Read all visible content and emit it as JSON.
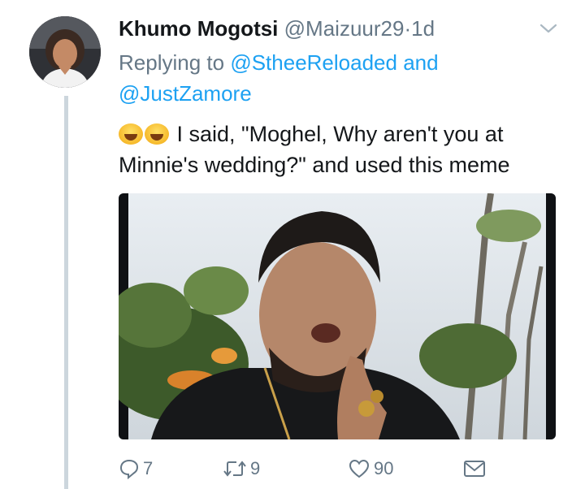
{
  "tweet": {
    "author_name": "Khumo Mogotsi",
    "author_handle": "@Maizuur29",
    "separator": "·",
    "time": "1d",
    "replying_prefix": "Replying to",
    "reply_target_1": "@StheeReloaded",
    "reply_joiner": "and",
    "reply_target_2": "@JustZamore",
    "emoji": "😂😂",
    "text": "I said, \"Moghel, Why aren't you at Minnie's wedding?\" and used this meme"
  },
  "actions": {
    "reply_count": "7",
    "retweet_count": "9",
    "like_count": "90"
  },
  "icons": {
    "menu": "chevron-down-icon",
    "reply": "reply-icon",
    "retweet": "retweet-icon",
    "like": "heart-icon",
    "message": "envelope-icon"
  },
  "colors": {
    "link": "#1da1f2",
    "secondary_text": "#657786",
    "thread_line": "#ccd6dd"
  }
}
